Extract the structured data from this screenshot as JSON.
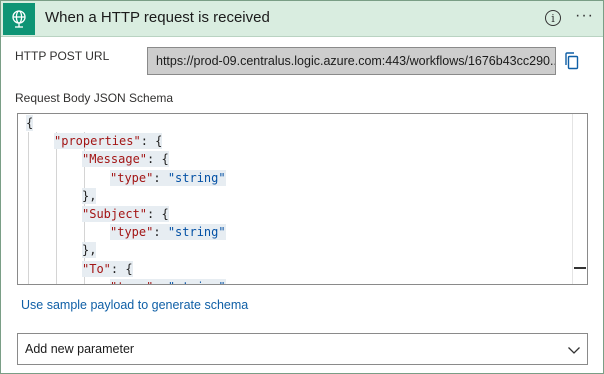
{
  "header": {
    "title": "When a HTTP request is received",
    "icon": "http-request-globe-icon",
    "info_icon": "info-icon",
    "more_icon": "more-icon",
    "info_glyph": "i",
    "more_glyph": "···",
    "accent": "#0e9475",
    "background": "#d9ede0"
  },
  "url_field": {
    "label": "HTTP POST URL",
    "value": "https://prod-09.centralus.logic.azure.com:443/workflows/1676b43cc290...",
    "copy_icon": "copy-icon"
  },
  "schema": {
    "label": "Request Body JSON Schema",
    "lines": [
      {
        "indent": 0,
        "key": "",
        "text": "{"
      },
      {
        "indent": 1,
        "key": "\"properties\"",
        "text": ": {"
      },
      {
        "indent": 2,
        "key": "\"Message\"",
        "text": ": {"
      },
      {
        "indent": 3,
        "key": "\"type\"",
        "text": ": ",
        "value": "\"string\""
      },
      {
        "indent": 2,
        "key": "",
        "text": "},"
      },
      {
        "indent": 2,
        "key": "\"Subject\"",
        "text": ": {"
      },
      {
        "indent": 3,
        "key": "\"type\"",
        "text": ": ",
        "value": "\"string\""
      },
      {
        "indent": 2,
        "key": "",
        "text": "},"
      },
      {
        "indent": 2,
        "key": "\"To\"",
        "text": ": {"
      },
      {
        "indent": 3,
        "key": "\"type\"",
        "text": ": ",
        "value": "\"string\""
      }
    ]
  },
  "sample_link": "Use sample payload to generate schema",
  "add_parameter": {
    "placeholder": "Add new parameter",
    "chevron_icon": "chevron-down-icon"
  }
}
